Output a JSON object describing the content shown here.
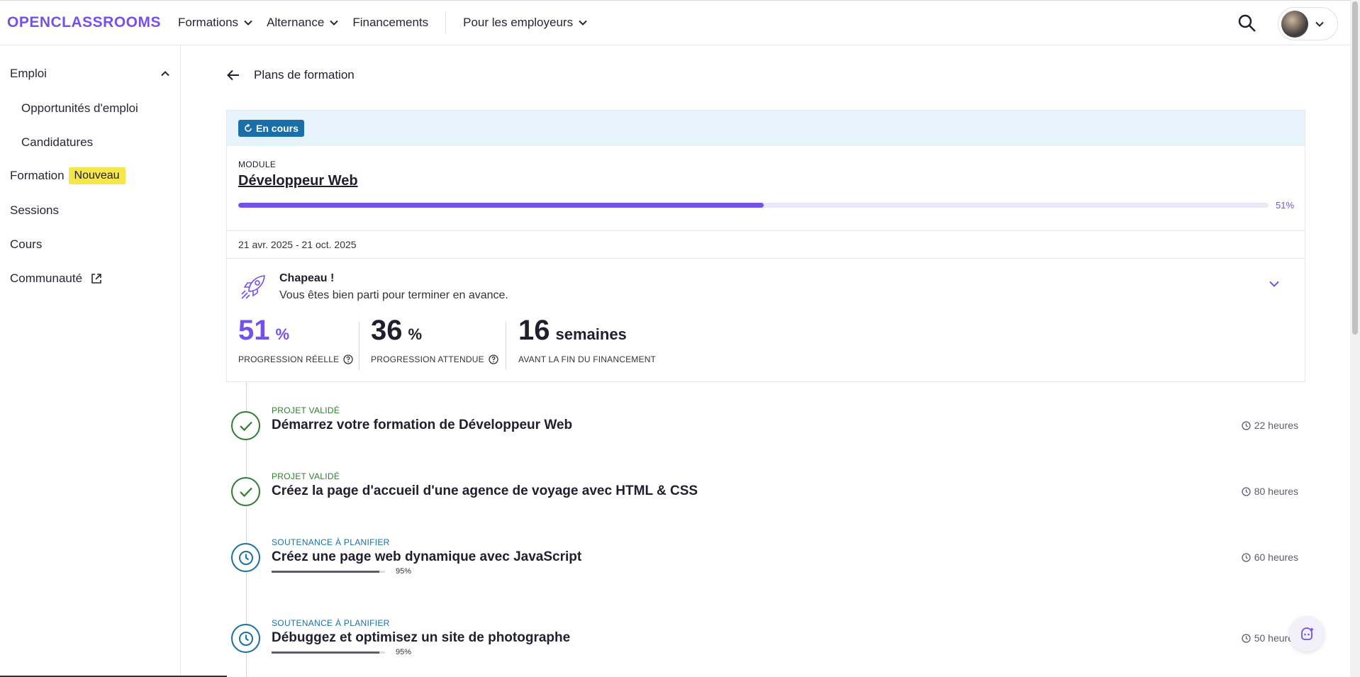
{
  "topnav": {
    "logo": "OPENCLASSROOMS",
    "items": [
      {
        "label": "Formations",
        "dropdown": true
      },
      {
        "label": "Alternance",
        "dropdown": true
      },
      {
        "label": "Financements",
        "dropdown": false
      }
    ],
    "employers": {
      "label": "Pour les employeurs",
      "dropdown": true
    },
    "search_icon": "search-icon",
    "avatar_icon": "user-avatar"
  },
  "sidebar": {
    "emploi": "Emploi",
    "opportunites": "Opportunités d'emploi",
    "candidatures": "Candidatures",
    "formation": "Formation",
    "formation_badge": "Nouveau",
    "sessions": "Sessions",
    "cours": "Cours",
    "communaute": "Communauté"
  },
  "main": {
    "back_label": "Plans de formation",
    "card": {
      "status": "En cours",
      "module_label": "MODULE",
      "module_title": "Développeur Web",
      "progress": 51,
      "progress_label": "51%",
      "date_range": "21 avr. 2025 - 21 oct. 2025",
      "congrats_title": "Chapeau !",
      "congrats_text": "Vous êtes bien parti pour terminer en avance.",
      "stats": [
        {
          "value": "51",
          "unit": "%",
          "label": "PROGRESSION RÉELLE",
          "help": true,
          "color": "#7451eb"
        },
        {
          "value": "36",
          "unit": "%",
          "label": "PROGRESSION ATTENDUE",
          "help": true,
          "color": "#1f1f2e"
        },
        {
          "value": "16",
          "unit": "semaines",
          "label": "AVANT LA FIN DU FINANCEMENT",
          "help": false,
          "color": "#1f1f2e"
        }
      ]
    },
    "projects": [
      {
        "status": "PROJET VALIDÉ",
        "state": "done",
        "title": "Démarrez votre formation de Développeur Web",
        "hours": "22 heures"
      },
      {
        "status": "PROJET VALIDÉ",
        "state": "done",
        "title": "Créez la page d'accueil d'une agence de voyage avec HTML & CSS",
        "hours": "80 heures"
      },
      {
        "status": "SOUTENANCE À PLANIFIER",
        "state": "plan",
        "title": "Créez une page web dynamique avec JavaScript",
        "hours": "60 heures",
        "progress": 95,
        "progress_label": "95%"
      },
      {
        "status": "SOUTENANCE À PLANIFIER",
        "state": "plan",
        "title": "Débuggez et optimisez un site de photographe",
        "hours": "50 heures",
        "progress": 95,
        "progress_label": "95%"
      }
    ]
  },
  "colors": {
    "accent": "#7451eb",
    "success": "#2e7d32",
    "info": "#1a6fa8",
    "badge_yellow": "#f5e64a"
  }
}
